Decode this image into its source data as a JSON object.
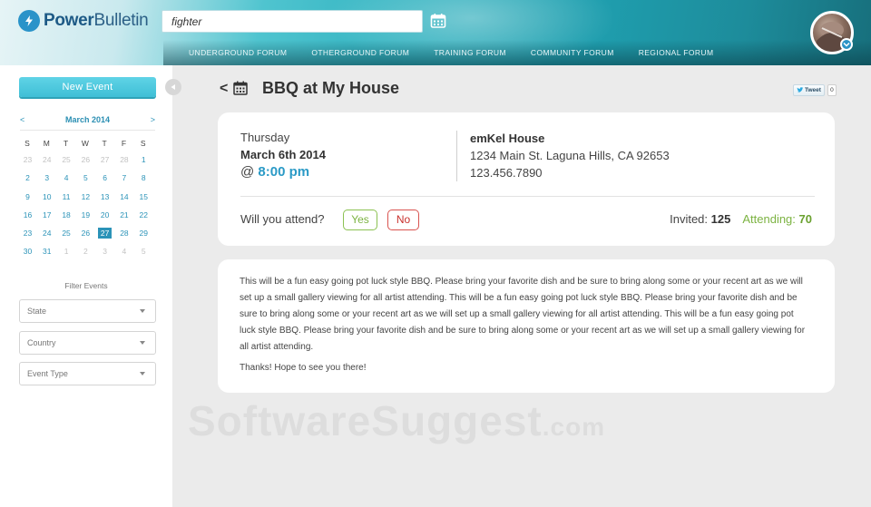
{
  "app": {
    "logo_text_bold": "Power",
    "logo_text_light": "Bulletin"
  },
  "search": {
    "value": "fighter",
    "placeholder": ""
  },
  "nav": {
    "items": [
      "UNDERGROUND FORUM",
      "OTHERGROUND FORUM",
      "TRAINING FORUM",
      "COMMUNITY FORUM",
      "REGIONAL FORUM"
    ]
  },
  "sidebar": {
    "new_event_label": "New Event",
    "calendar": {
      "prev": "<",
      "next": ">",
      "month_label": "March 2014",
      "weekdays": [
        "S",
        "M",
        "T",
        "W",
        "T",
        "F",
        "S"
      ],
      "weeks": [
        [
          {
            "d": "23",
            "muted": true
          },
          {
            "d": "24",
            "muted": true
          },
          {
            "d": "25",
            "muted": true
          },
          {
            "d": "26",
            "muted": true
          },
          {
            "d": "27",
            "muted": true
          },
          {
            "d": "28",
            "muted": true
          },
          {
            "d": "1",
            "muted": false
          }
        ],
        [
          {
            "d": "2",
            "muted": false
          },
          {
            "d": "3",
            "muted": false
          },
          {
            "d": "4",
            "muted": false
          },
          {
            "d": "5",
            "muted": false
          },
          {
            "d": "6",
            "muted": false
          },
          {
            "d": "7",
            "muted": false
          },
          {
            "d": "8",
            "muted": false
          }
        ],
        [
          {
            "d": "9",
            "muted": false
          },
          {
            "d": "10",
            "muted": false
          },
          {
            "d": "11",
            "muted": false
          },
          {
            "d": "12",
            "muted": false
          },
          {
            "d": "13",
            "muted": false
          },
          {
            "d": "14",
            "muted": false
          },
          {
            "d": "15",
            "muted": false
          }
        ],
        [
          {
            "d": "16",
            "muted": false
          },
          {
            "d": "17",
            "muted": false
          },
          {
            "d": "18",
            "muted": false
          },
          {
            "d": "19",
            "muted": false
          },
          {
            "d": "20",
            "muted": false
          },
          {
            "d": "21",
            "muted": false
          },
          {
            "d": "22",
            "muted": false
          }
        ],
        [
          {
            "d": "23",
            "muted": false
          },
          {
            "d": "24",
            "muted": false
          },
          {
            "d": "25",
            "muted": false
          },
          {
            "d": "26",
            "muted": false
          },
          {
            "d": "27",
            "muted": false,
            "today": true
          },
          {
            "d": "28",
            "muted": false
          },
          {
            "d": "29",
            "muted": false
          }
        ],
        [
          {
            "d": "30",
            "muted": false
          },
          {
            "d": "31",
            "muted": false
          },
          {
            "d": "1",
            "muted": true
          },
          {
            "d": "2",
            "muted": true
          },
          {
            "d": "3",
            "muted": true
          },
          {
            "d": "4",
            "muted": true
          },
          {
            "d": "5",
            "muted": true
          }
        ]
      ]
    },
    "filter": {
      "title": "Filter Events",
      "state": "State",
      "country": "Country",
      "event_type": "Event Type"
    }
  },
  "event": {
    "back": "<",
    "title": "BBQ at My House",
    "tweet_label": "Tweet",
    "tweet_count": "0",
    "day": "Thursday",
    "date": "March 6th 2014",
    "at": "@",
    "time": "8:00 pm",
    "venue": "emKel House",
    "address": "1234 Main St. Laguna Hills, CA 92653",
    "phone": "123.456.7890",
    "attend_question": "Will you attend?",
    "yes_label": "Yes",
    "no_label": "No",
    "invited_label": "Invited:",
    "invited_count": "125",
    "attending_label": "Attending:",
    "attending_count": "70",
    "description": "This will be a fun easy going pot luck style BBQ. Please bring your favorite dish and be sure to bring along some or your recent art as we will set up a small gallery viewing for all artist attending.  This will be a fun easy going pot luck style BBQ. Please bring your favorite dish and be sure to bring along some or your recent art as we will set up a small gallery viewing for all artist attending.  This will be a fun easy going pot luck style BBQ. Please bring your favorite dish and be sure to bring along some or your recent art as we will set up a small gallery viewing for all artist attending.",
    "closing": "Thanks! Hope to see you there!"
  },
  "watermark": {
    "main": "SoftwareSuggest",
    "suffix": ".com"
  },
  "colors": {
    "accent": "#2b93b8",
    "time": "#2b9ac6",
    "yes": "#7cb342",
    "no": "#c9302c"
  },
  "icons": {
    "logo": "lightning-bolt-icon",
    "calendar": "calendar-icon",
    "collapse": "triangle-left-icon",
    "avatar_badge": "chevron-down-icon",
    "tweet": "twitter-bird-icon"
  }
}
